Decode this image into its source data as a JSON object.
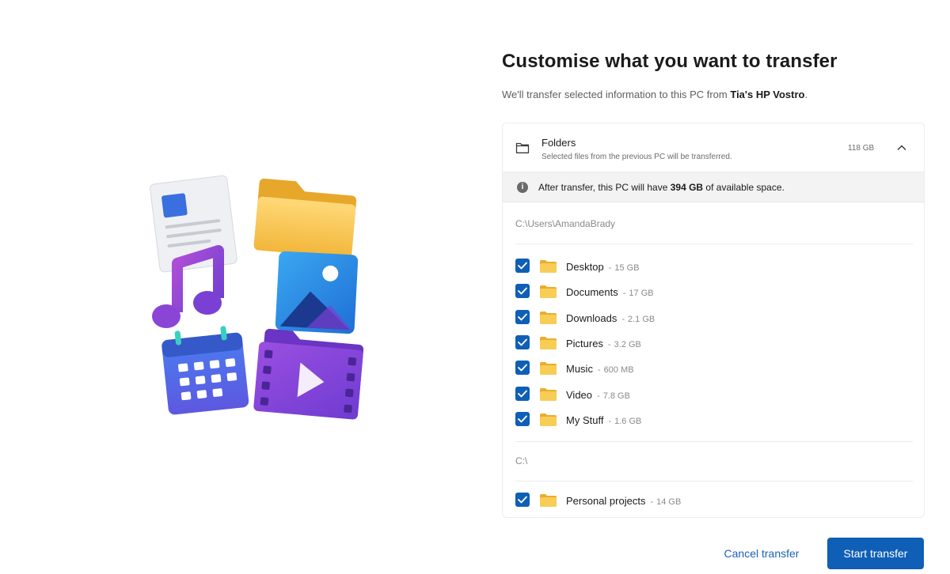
{
  "dialog": {
    "title": "Customise what you want to transfer",
    "subtitle_prefix": "We'll transfer selected information to this PC from ",
    "source_pc": "Tia's HP Vostro",
    "subtitle_suffix": "."
  },
  "folders_section": {
    "icon": "folder-outline-icon",
    "title": "Folders",
    "description": "Selected files from the previous PC will be transferred.",
    "size": "118 GB",
    "expanded": true
  },
  "info": {
    "icon": "info-icon",
    "text_prefix": "After transfer, this PC will have ",
    "space": "394 GB",
    "text_suffix": " of available space."
  },
  "groups": [
    {
      "path": "C:\\Users\\AmandaBrady",
      "items": [
        {
          "name": "Desktop",
          "size": "15 GB",
          "checked": true
        },
        {
          "name": "Documents",
          "size": "17 GB",
          "checked": true
        },
        {
          "name": "Downloads",
          "size": "2.1 GB",
          "checked": true
        },
        {
          "name": "Pictures",
          "size": "3.2 GB",
          "checked": true
        },
        {
          "name": "Music",
          "size": "600 MB",
          "checked": true
        },
        {
          "name": "Video",
          "size": "7.8 GB",
          "checked": true
        },
        {
          "name": "My Stuff",
          "size": "1.6 GB",
          "checked": true
        }
      ]
    },
    {
      "path": "C:\\",
      "items": [
        {
          "name": "Personal projects",
          "size": "14 GB",
          "checked": true
        }
      ]
    }
  ],
  "footer": {
    "cancel_label": "Cancel transfer",
    "start_label": "Start transfer"
  },
  "colors": {
    "accent": "#0f5fb7",
    "link": "#1a62b8",
    "folder_yellow": "#f5c84c"
  }
}
